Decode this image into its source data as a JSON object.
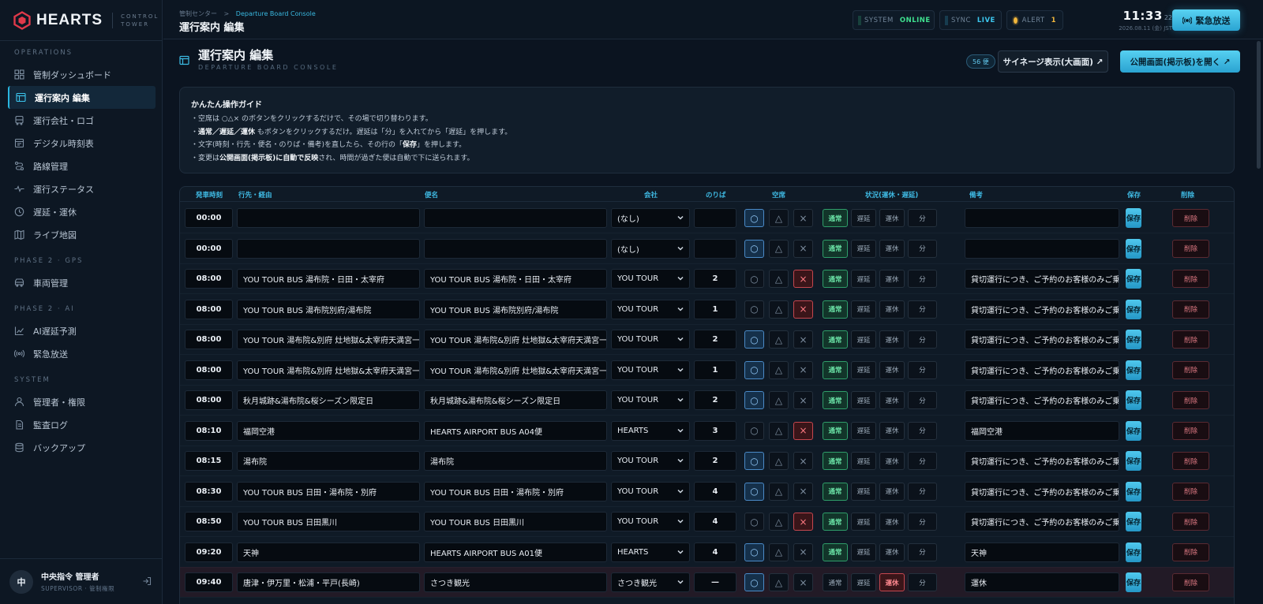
{
  "brand": {
    "name": "HEARTS",
    "sub": "CONTROL TOWER"
  },
  "sidebar": {
    "sections": [
      {
        "title": "OPERATIONS",
        "items": [
          {
            "label": "管制ダッシュボード",
            "icon": "dashboard-icon"
          },
          {
            "label": "運行案内 編集",
            "icon": "board-icon",
            "active": true
          },
          {
            "label": "運行会社・ロゴ",
            "icon": "bus-icon"
          },
          {
            "label": "デジタル時刻表",
            "icon": "timetable-icon"
          },
          {
            "label": "路線管理",
            "icon": "route-icon"
          },
          {
            "label": "運行ステータス",
            "icon": "pulse-icon"
          },
          {
            "label": "遅延・運休",
            "icon": "clock-icon"
          },
          {
            "label": "ライブ地図",
            "icon": "map-icon"
          }
        ]
      },
      {
        "title": "PHASE 2 · GPS",
        "items": [
          {
            "label": "車両管理",
            "icon": "vehicle-icon"
          }
        ]
      },
      {
        "title": "PHASE 2 · AI",
        "items": [
          {
            "label": "AI遅延予測",
            "icon": "chart-icon"
          },
          {
            "label": "緊急放送",
            "icon": "broadcast-icon"
          }
        ]
      },
      {
        "title": "SYSTEM",
        "items": [
          {
            "label": "管理者・権限",
            "icon": "user-icon"
          },
          {
            "label": "監査ログ",
            "icon": "log-icon"
          },
          {
            "label": "バックアップ",
            "icon": "database-icon"
          }
        ]
      }
    ],
    "user": {
      "initial": "中",
      "name": "中央指令 管理者",
      "role": "SUPERVISOR · 管制権限"
    }
  },
  "topbar": {
    "breadcrumb_root": "管制センター",
    "breadcrumb_sep": ">",
    "breadcrumb_current": "Departure Board Console",
    "title": "運行案内 編集",
    "status": [
      {
        "label": "SYSTEM",
        "value": "ONLINE",
        "color": "#3fe08f"
      },
      {
        "label": "SYNC",
        "value": "LIVE",
        "color": "#3cc6ee"
      },
      {
        "label": "ALERT",
        "value": "1",
        "color": "#f0b63c"
      }
    ],
    "clock": "11:33",
    "clock_sec": "22",
    "date": "2026.08.11 (金) JST",
    "alarm_label": "緊急放送"
  },
  "page": {
    "title": "運行案内 編集",
    "subtitle": "DEPARTURE BOARD CONSOLE",
    "count": "56 便",
    "signage_label": "サイネージ表示(大画面) ↗",
    "public_label": "公開画面(掲示板)を開く ↗"
  },
  "guide": {
    "title": "かんたん操作ガイド",
    "l1": "・空席は ○△× のボタンをクリックするだけで、その場で切り替わります。",
    "l2a": "・",
    "l2b": "通常／遅延／運休",
    "l2c": " もボタンをクリックするだけ。遅延は「分」を入れてから「遅延」を押します。",
    "l3a": "・文字(時刻・行先・便名・のりば・備考)を直したら、その行の「",
    "l3b": "保存",
    "l3c": "」を押します。",
    "l4a": "・変更は",
    "l4b": "公開画面(掲示板)に自動で反映",
    "l4c": "され、時間が過ぎた便は自動で下に送られます。"
  },
  "table": {
    "headers": {
      "time": "発車時刻",
      "dest": "行先・経由",
      "name": "便名",
      "company": "会社",
      "platform": "のりば",
      "seats": "空席",
      "status": "状況(運休・遅延)",
      "note": "備考",
      "save": "保存",
      "del": "削除"
    },
    "seat_labels": [
      "○",
      "△",
      "×"
    ],
    "status_labels": [
      "通常",
      "遅延",
      "運休",
      "分"
    ],
    "save_label": "保存",
    "del_label": "削除",
    "rows": [
      {
        "time": "00:00",
        "dest": "",
        "name": "",
        "company": "(なし)",
        "platform": "",
        "seat": 0,
        "status": 0,
        "note": ""
      },
      {
        "time": "00:00",
        "dest": "",
        "name": "",
        "company": "(なし)",
        "platform": "",
        "seat": 0,
        "status": 0,
        "note": ""
      },
      {
        "time": "08:00",
        "dest": "YOU TOUR BUS 湯布院・日田・太宰府",
        "name": "YOU TOUR BUS 湯布院・日田・太宰府",
        "company": "YOU TOUR",
        "platform": "2",
        "seat": 2,
        "status": 0,
        "note": "貸切運行につき、ご予約のお客様のみご乗車"
      },
      {
        "time": "08:00",
        "dest": "YOU TOUR BUS 湯布院別府/湯布院",
        "name": "YOU TOUR BUS 湯布院別府/湯布院",
        "company": "YOU TOUR",
        "platform": "1",
        "seat": 2,
        "status": 0,
        "note": "貸切運行につき、ご予約のお客様のみご乗車"
      },
      {
        "time": "08:00",
        "dest": "YOU TOUR 湯布院&別府 灶地獄&太宰府天満宮一日",
        "name": "YOU TOUR 湯布院&別府 灶地獄&太宰府天満宮一日",
        "company": "YOU TOUR",
        "platform": "2",
        "seat": 0,
        "status": 0,
        "note": "貸切運行につき、ご予約のお客様のみご乗車"
      },
      {
        "time": "08:00",
        "dest": "YOU TOUR 湯布院&別府 灶地獄&太宰府天満宮一日",
        "name": "YOU TOUR 湯布院&別府 灶地獄&太宰府天満宮一日",
        "company": "YOU TOUR",
        "platform": "1",
        "seat": 0,
        "status": 0,
        "note": "貸切運行につき、ご予約のお客様のみご乗車"
      },
      {
        "time": "08:00",
        "dest": "秋月城跡&湯布院&桜シーズン限定日",
        "name": "秋月城跡&湯布院&桜シーズン限定日",
        "company": "YOU TOUR",
        "platform": "2",
        "seat": 0,
        "status": 0,
        "note": "貸切運行につき、ご予約のお客様のみご乗車"
      },
      {
        "time": "08:10",
        "dest": "福岡空港",
        "name": "HEARTS AIRPORT BUS A04便",
        "company": "HEARTS",
        "platform": "3",
        "seat": 2,
        "status": 0,
        "note": "福岡空港"
      },
      {
        "time": "08:15",
        "dest": "湯布院",
        "name": "湯布院",
        "company": "YOU TOUR",
        "platform": "2",
        "seat": 0,
        "status": 0,
        "note": "貸切運行につき、ご予約のお客様のみご乗車"
      },
      {
        "time": "08:30",
        "dest": "YOU TOUR BUS 日田・湯布院・別府",
        "name": "YOU TOUR BUS 日田・湯布院・別府",
        "company": "YOU TOUR",
        "platform": "4",
        "seat": 0,
        "status": 0,
        "note": "貸切運行につき、ご予約のお客様のみご乗車"
      },
      {
        "time": "08:50",
        "dest": "YOU TOUR BUS 日田黒川",
        "name": "YOU TOUR BUS 日田黒川",
        "company": "YOU TOUR",
        "platform": "4",
        "seat": 2,
        "status": 0,
        "note": "貸切運行につき、ご予約のお客様のみご乗車"
      },
      {
        "time": "09:20",
        "dest": "天神",
        "name": "HEARTS AIRPORT BUS A01便",
        "company": "HEARTS",
        "platform": "4",
        "seat": 0,
        "status": 0,
        "note": "天神"
      },
      {
        "time": "09:40",
        "dest": "唐津・伊万里・松浦・平戸(長崎)",
        "name": "さつき観光",
        "company": "さつき観光",
        "platform": "—",
        "seat": 0,
        "status": 2,
        "note": "運休"
      }
    ]
  }
}
